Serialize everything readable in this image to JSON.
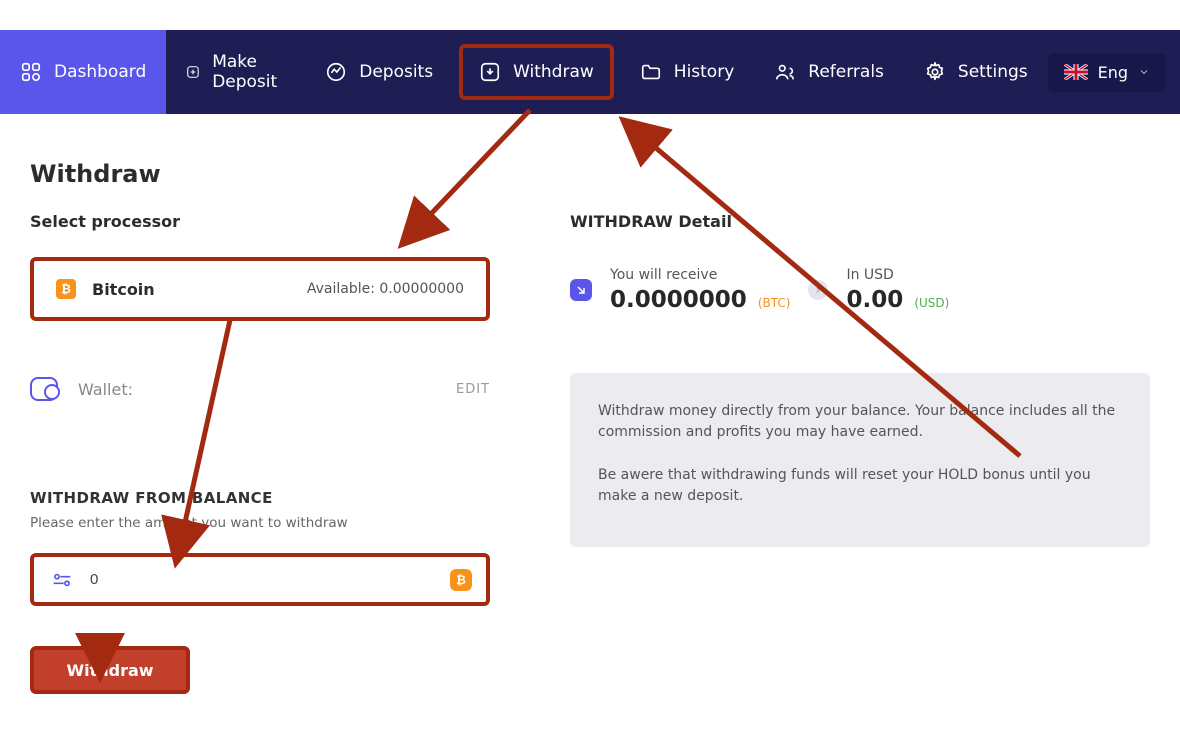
{
  "nav": {
    "dashboard": "Dashboard",
    "make_deposit": "Make Deposit",
    "deposits": "Deposits",
    "withdraw": "Withdraw",
    "history": "History",
    "referrals": "Referrals",
    "settings": "Settings",
    "lang": "Eng"
  },
  "page": {
    "title": "Withdraw",
    "select_processor": "Select processor",
    "processor_name": "Bitcoin",
    "processor_available": "Available: 0.00000000",
    "wallet_label": "Wallet:",
    "edit": "EDIT",
    "from_balance": "WITHDRAW FROM BALANCE",
    "amount_prompt": "Please enter the amount you want to withdraw",
    "amount_value": "0",
    "withdraw_btn": "Withdraw"
  },
  "detail": {
    "title": "WITHDRAW Detail",
    "receive_label": "You will receive",
    "receive_value": "0.0000000",
    "receive_unit": "(BTC)",
    "usd_label": "In USD",
    "usd_value": "0.00",
    "usd_unit": "(USD)",
    "info1": "Withdraw money directly from your balance. Your balance includes all the commission and profits you may have earned.",
    "info2": "Be awere that withdrawing funds will reset your HOLD bonus until you make a new deposit."
  }
}
